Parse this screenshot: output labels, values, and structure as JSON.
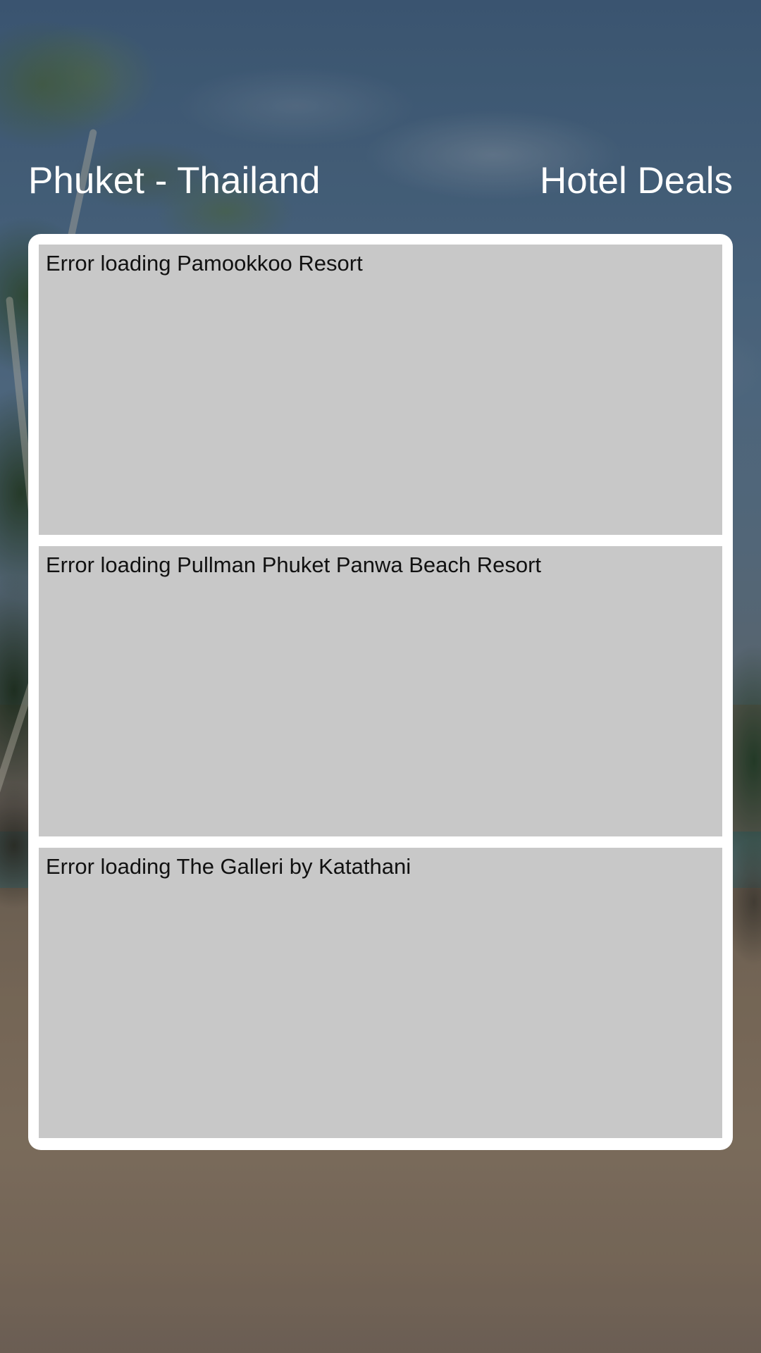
{
  "header": {
    "title": "Phuket - Thailand",
    "subtitle": "Hotel Deals"
  },
  "hotels": [
    {
      "message": "Error loading Pamookkoo Resort"
    },
    {
      "message": "Error loading Pullman Phuket Panwa Beach Resort"
    },
    {
      "message": "Error loading The Galleri by Katathani"
    }
  ],
  "colors": {
    "header_text": "#ffffff",
    "panel_background": "#ffffff",
    "card_placeholder": "#c8c8c8",
    "card_text": "#111111"
  },
  "background": {
    "scene": "tropical-beach-photo"
  }
}
